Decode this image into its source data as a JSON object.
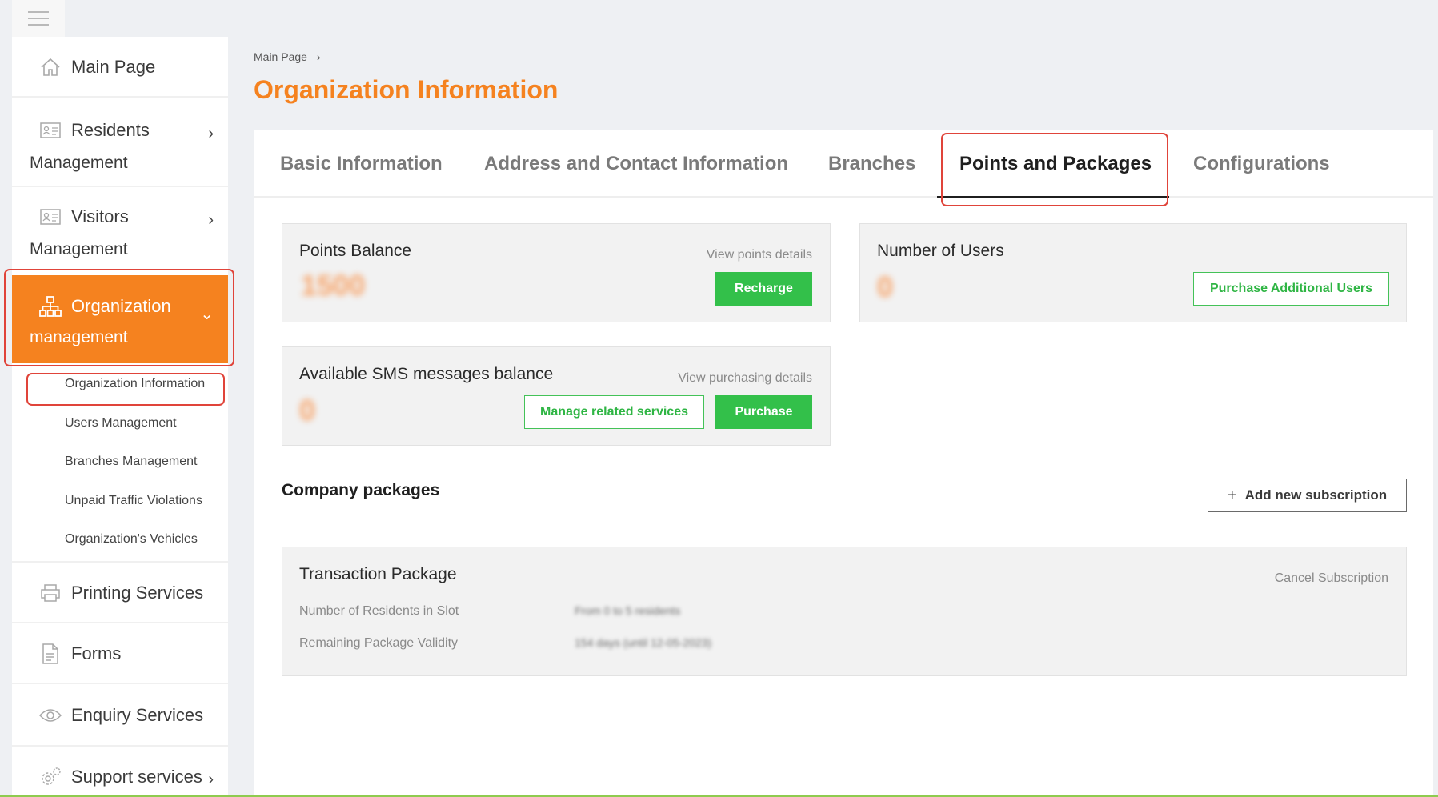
{
  "sidebar": {
    "items": [
      {
        "label": "Main Page",
        "icon": "home-icon"
      },
      {
        "label": "Residents",
        "label2": "Management",
        "icon": "id-card-icon"
      },
      {
        "label": "Visitors",
        "label2": "Management",
        "icon": "id-card-icon"
      },
      {
        "label": "Organization",
        "label2": "management",
        "icon": "org-chart-icon"
      },
      {
        "label": "Printing Services",
        "icon": "printer-icon"
      },
      {
        "label": "Forms",
        "icon": "document-icon"
      },
      {
        "label": "Enquiry Services",
        "icon": "eye-icon"
      },
      {
        "label": "Support services",
        "icon": "gear-icon"
      }
    ],
    "subitems": [
      "Organization Information",
      "Users Management",
      "Branches Management",
      "Unpaid Traffic Violations",
      "Organization's Vehicles"
    ]
  },
  "breadcrumb": {
    "item": "Main Page",
    "separator": "›"
  },
  "page_title": "Organization Information",
  "tabs": [
    "Basic Information",
    "Address and Contact Information",
    "Branches",
    "Points and Packages",
    "Configurations"
  ],
  "cards": {
    "points": {
      "title": "Points Balance",
      "link": "View points details",
      "value": "1500",
      "button": "Recharge"
    },
    "users": {
      "title": "Number of Users",
      "value": "0",
      "button": "Purchase Additional Users"
    },
    "sms": {
      "title": "Available SMS messages balance",
      "link": "View purchasing details",
      "value": "0",
      "button_secondary": "Manage related services",
      "button_primary": "Purchase"
    }
  },
  "packages": {
    "section_title": "Company packages",
    "add_button": "Add new subscription",
    "add_icon": "+",
    "package": {
      "title": "Transaction Package",
      "cancel": "Cancel Subscription",
      "rows": [
        {
          "label": "Number of Residents in Slot",
          "value": "From 0 to 5 residents"
        },
        {
          "label": "Remaining Package Validity",
          "value": "154 days (until 12-05-2023)"
        }
      ]
    }
  },
  "colors": {
    "accent": "#f5821f",
    "green": "#33c04a",
    "highlight": "#e0443a"
  }
}
